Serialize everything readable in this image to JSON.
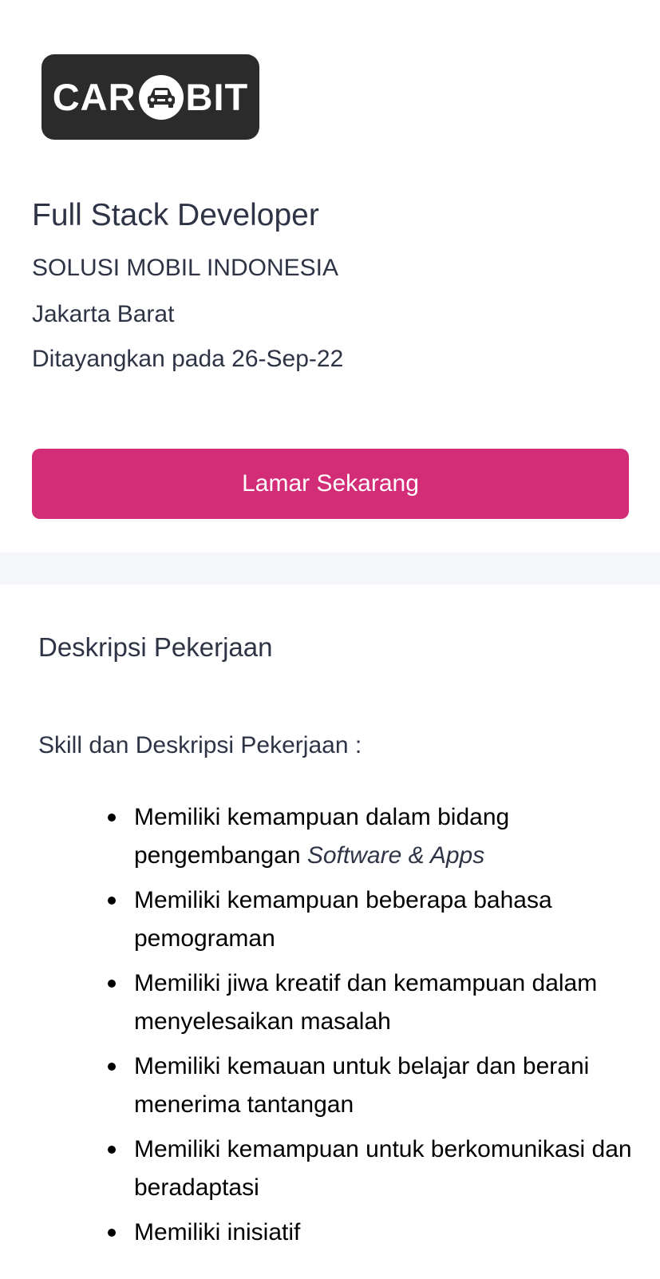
{
  "logo": {
    "text_left": "CAR",
    "text_right": "BIT",
    "icon": "car-icon"
  },
  "job": {
    "title": "Full Stack Developer",
    "company": "SOLUSI MOBIL INDONESIA",
    "location": "Jakarta Barat",
    "posted": "Ditayangkan pada 26-Sep-22"
  },
  "apply_button": {
    "label": "Lamar Sekarang"
  },
  "description": {
    "heading": "Deskripsi Pekerjaan",
    "intro": "Skill dan Deskripsi Pekerjaan :",
    "items": [
      {
        "text": "Memiliki kemampuan dalam bidang pengembangan ",
        "emphasis": "Software & Apps"
      },
      {
        "text": "Memiliki kemampuan beberapa bahasa pemograman"
      },
      {
        "text": "Memiliki jiwa kreatif dan kemampuan dalam menyelesaikan masalah"
      },
      {
        "text": "Memiliki kemauan untuk belajar dan berani menerima tantangan"
      },
      {
        "text": "Memiliki kemampuan untuk berkomunikasi dan beradaptasi"
      },
      {
        "text": "Memiliki inisiatif"
      }
    ]
  },
  "colors": {
    "accent": "#d42d77",
    "logo_bg": "#2b2b2b",
    "text": "#2e3445",
    "divider": "#f5f6fa"
  }
}
